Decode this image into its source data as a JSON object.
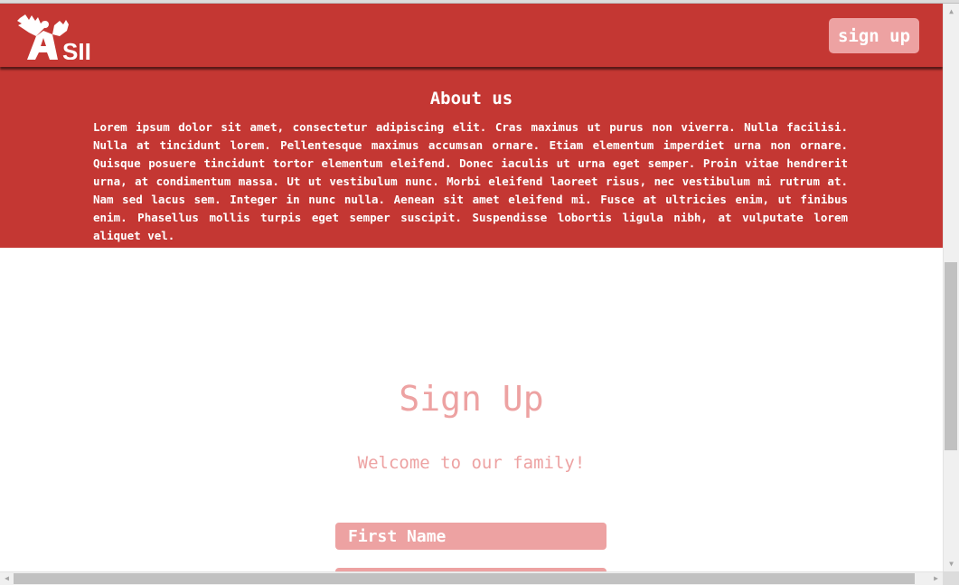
{
  "header": {
    "logo_text": "SII",
    "signup_button": "sign up"
  },
  "about": {
    "title": "About us",
    "body": "Lorem ipsum dolor sit amet, consectetur adipiscing elit. Cras maximus ut purus non viverra. Nulla facilisi. Nulla at tincidunt lorem. Pellentesque maximus accumsan ornare. Etiam elementum imperdiet urna non ornare. Quisque posuere tincidunt tortor elementum eleifend. Donec iaculis ut urna eget semper. Proin vitae hendrerit urna, at condimentum massa. Ut ut vestibulum nunc. Morbi eleifend laoreet risus, nec vestibulum mi rutrum at. Nam sed lacus sem. Integer in nunc nulla. Aenean sit amet eleifend mi. Fusce at ultricies enim, ut finibus enim. Phasellus mollis turpis eget semper suscipit. Suspendisse lobortis ligula nibh, at vulputate lorem aliquet vel."
  },
  "signup": {
    "title": "Sign Up",
    "subtitle": "Welcome to our family!",
    "first_name_placeholder": "First Name"
  },
  "colors": {
    "brand_red": "#c43733",
    "accent_pink": "#eda2a2"
  },
  "icons": {
    "logo": "hands-logo-icon"
  }
}
